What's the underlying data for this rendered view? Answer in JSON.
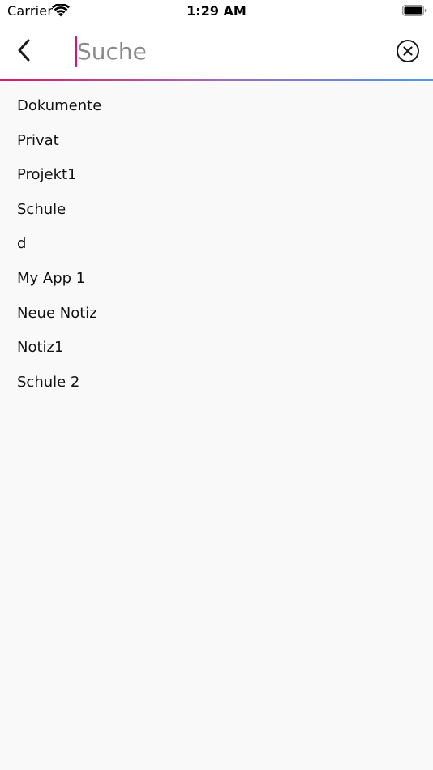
{
  "status_bar": {
    "carrier": "Carrier",
    "time": "1:29 AM",
    "wifi_icon": "wifi-icon",
    "battery_icon": "battery-icon"
  },
  "header": {
    "back_icon": "chevron-left-icon",
    "search_placeholder": "Suche",
    "search_value": "",
    "clear_icon": "close-circle-icon",
    "accent_gradient": [
      "#d81b6b",
      "#a36ab8",
      "#4a9be8"
    ],
    "caret_color": "#e0106e"
  },
  "results": [
    "Dokumente",
    "Privat",
    "Projekt1",
    "Schule",
    "d",
    "My App 1",
    "Neue Notiz",
    "Notiz1",
    "Schule 2"
  ]
}
